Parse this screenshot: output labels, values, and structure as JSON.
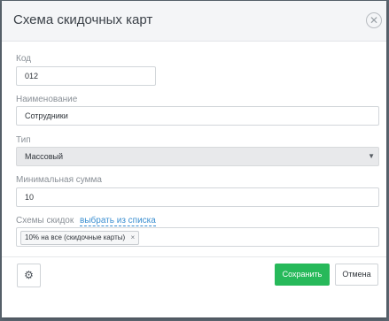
{
  "dialog": {
    "title": "Схема скидочных карт",
    "close_icon": "close-icon",
    "close_glyph": "✕"
  },
  "fields": {
    "code": {
      "label": "Код",
      "value": "012"
    },
    "name": {
      "label": "Наименование",
      "value": "Сотрудники"
    },
    "type": {
      "label": "Тип",
      "value": "Массовый",
      "arrow_glyph": "▼"
    },
    "min_sum": {
      "label": "Минимальная сумма",
      "value": "10"
    },
    "discount_schemes": {
      "label": "Схемы скидок",
      "link": "выбрать из списка",
      "tags": [
        {
          "text": "10% на все (скидочные карты)",
          "remove_glyph": "×"
        }
      ]
    }
  },
  "footer": {
    "settings_glyph": "⚙",
    "save_label": "Сохранить",
    "cancel_label": "Отмена"
  },
  "colors": {
    "header_bg": "#f4f5f7",
    "link": "#3b8fd1",
    "save_button": "#27b95a"
  }
}
